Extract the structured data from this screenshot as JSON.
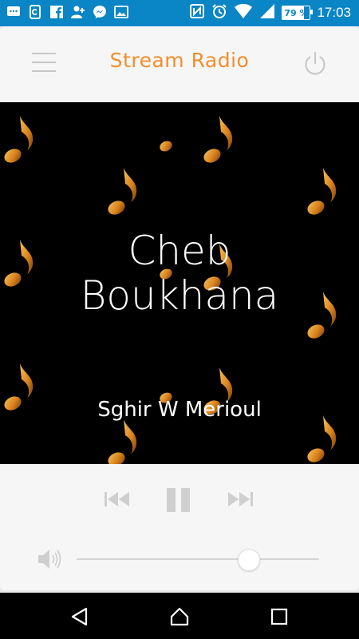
{
  "statusbar": {
    "time": "17:03",
    "battery_percent": "79 %",
    "battery_level": 0.79,
    "left_icons": [
      "chat-bubble-icon",
      "clipboard-icon",
      "facebook-icon",
      "add-person-icon",
      "messenger-icon",
      "image-icon"
    ],
    "right_icons": [
      "nfc-icon",
      "alarm-icon",
      "wifi-icon",
      "signal-icon",
      "battery-icon"
    ]
  },
  "appbar": {
    "title": "Stream Radio",
    "menu_icon": "hamburger-menu-icon",
    "power_icon": "power-icon"
  },
  "player": {
    "song_title_line1": "Cheb",
    "song_title_line2": "Boukhana",
    "artist": "Sghir W Merioul",
    "background_pattern_icon": "music-note-icon",
    "volume_level": 0.71
  },
  "controls": {
    "previous_icon": "skip-previous-icon",
    "pause_icon": "pause-icon",
    "next_icon": "skip-next-icon",
    "volume_icon": "speaker-icon"
  },
  "colors": {
    "statusbar": "#0a85c5",
    "accent": "#f08f2e",
    "artwork_bg": "#000000",
    "control_gray": "#cfcfcf"
  },
  "navbar": {
    "back_icon": "back-triangle-icon",
    "home_icon": "home-icon",
    "recents_icon": "recents-square-icon"
  }
}
